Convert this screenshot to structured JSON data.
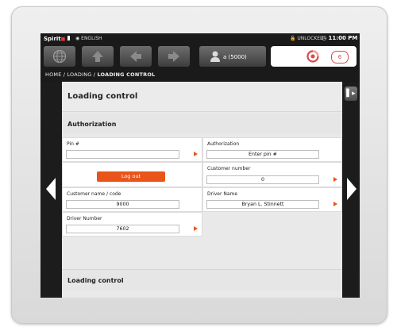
{
  "status_bar": {
    "brand": "Spirit",
    "language": "ENGLISH",
    "lock_state": "UNLOCKED",
    "time": "11:00 PM"
  },
  "toolbar": {
    "user_label": "a (5000)",
    "alarm_count": "6",
    "icons": [
      "globe-icon",
      "up-arrow-icon",
      "back-arrow-icon",
      "forward-arrow-icon",
      "user-icon",
      "alarm-icon"
    ]
  },
  "breadcrumb": {
    "path": "HOME / LOADING / ",
    "current": "LOADING CONTROL"
  },
  "page": {
    "title": "Loading control",
    "authorization_header": "Authorization",
    "loading_control_header": "Loading control"
  },
  "form": {
    "pin": {
      "label": "Pin #",
      "value": ""
    },
    "authorization": {
      "label": "Authorization",
      "value": "Enter pin #"
    },
    "logout_button": "Log out",
    "customer_number": {
      "label": "Customer number",
      "value": "0"
    },
    "customer_name_code": {
      "label": "Customer name / code",
      "value": "9000"
    },
    "driver_name": {
      "label": "Driver Name",
      "value": "Bryan L. Stinnett"
    },
    "driver_number": {
      "label": "Driver Number",
      "value": "7602"
    }
  },
  "colors": {
    "accent": "#e8541a",
    "alarm": "#d84a4a",
    "screen_bg": "#1a1a1a",
    "panel_bg": "#e9e9e9"
  }
}
